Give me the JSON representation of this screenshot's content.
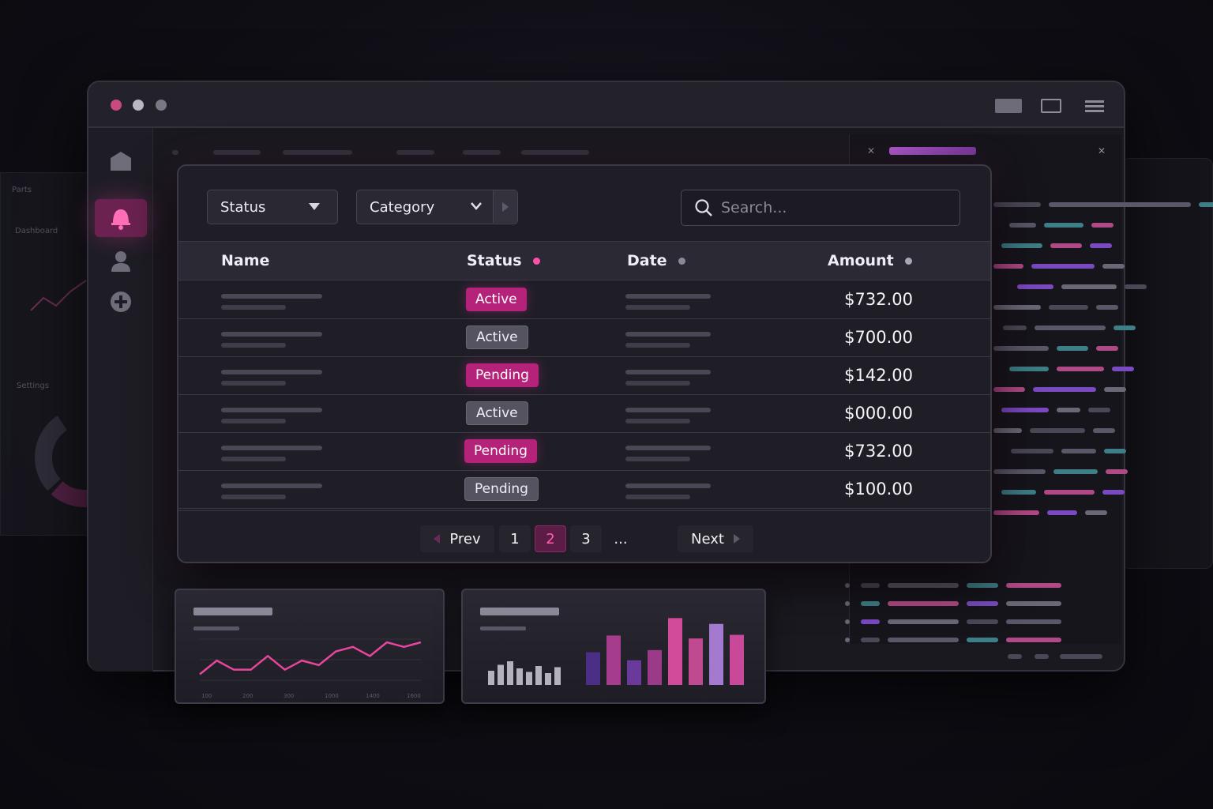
{
  "background": {
    "left_window": {
      "labels": [
        "Dashboard",
        "Settings"
      ]
    }
  },
  "toolbar": {
    "filters": [
      {
        "label": "Status"
      },
      {
        "label": "Category"
      }
    ],
    "search": {
      "placeholder": "Search...",
      "value": ""
    }
  },
  "table": {
    "columns": [
      "Name",
      "Status",
      "Date",
      "Amount"
    ],
    "rows": [
      {
        "status": "Active",
        "status_style": "pink",
        "amount": "$732.00"
      },
      {
        "status": "Active",
        "status_style": "gray",
        "amount": "$700.00"
      },
      {
        "status": "Pending",
        "status_style": "pink",
        "amount": "$142.00"
      },
      {
        "status": "Active",
        "status_style": "gray",
        "amount": "$000.00"
      },
      {
        "status": "Pending",
        "status_style": "pink",
        "amount": "$732.00"
      },
      {
        "status": "Pending",
        "status_style": "gray",
        "amount": "$100.00"
      }
    ]
  },
  "pagination": {
    "prev_label": "Prev",
    "next_label": "Next",
    "pages": [
      "1",
      "2",
      "3"
    ],
    "current_page": "2",
    "ellipsis": "..."
  },
  "colors": {
    "accent": "#b5227a",
    "accent_bright": "#ff5fb4",
    "background": "#1a1920"
  },
  "line_card": {
    "line_values": [
      2,
      5,
      3,
      3,
      6,
      3,
      5,
      4,
      7,
      8,
      6,
      9,
      8,
      9
    ],
    "tick_labels": [
      "100",
      "200",
      "300",
      "1000",
      "1400",
      "1600"
    ]
  },
  "bar_card": {
    "gray_bars": [
      0.6,
      0.85,
      1.0,
      0.7,
      0.55,
      0.8,
      0.5,
      0.75
    ],
    "color_bars": [
      0.45,
      0.68,
      0.34,
      0.48,
      0.92,
      0.64,
      0.84,
      0.69
    ]
  }
}
